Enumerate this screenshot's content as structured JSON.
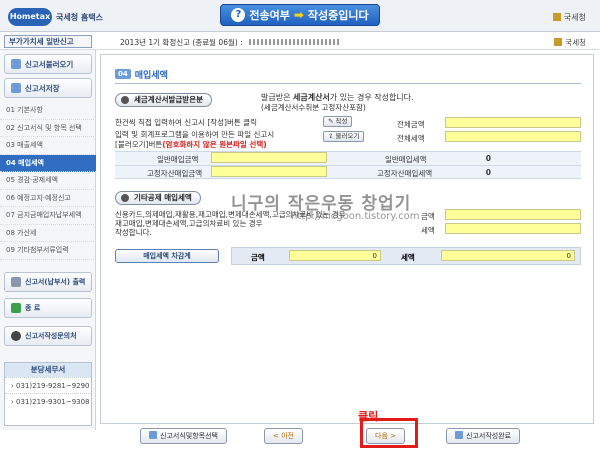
{
  "header": {
    "logo": "Hometax",
    "site_name": "국세청 홈택스",
    "banner_left": "전송여부",
    "banner_right": "작성중입니다",
    "brand": "국세청"
  },
  "subheader": {
    "tab": "부가가치세 일반신고",
    "filing_title": "2013년 1기 확정신고 (종료월 06월) :",
    "brand": "국세청"
  },
  "sidebar": {
    "buttons": {
      "load": "신고서불러오기",
      "save": "신고서저장"
    },
    "menu": [
      "01 기본사항",
      "02 신고서식 및 항목 선택",
      "03 매출세액",
      "04 매입세액",
      "05 경감·공제세액",
      "06 예정고지·예정신고",
      "07 금지금매입자납부세액",
      "08 가산세",
      "09 기타첨부서류입력"
    ],
    "active_index": 3,
    "print_btn": "신고서(납부서) 출력",
    "end_btn": "종 료",
    "contact_btn": "신고서작성문의처",
    "tax_office": {
      "title": "분당세무서",
      "phones": [
        "031)219-9281~9290",
        "031)219-9301~9308"
      ]
    }
  },
  "main": {
    "section_number": "04",
    "section_title": "매입세액",
    "panel1": {
      "label": "세금계산서발급받은분",
      "desc_prefix": "발급받은 ",
      "desc_bold": "세금계산서",
      "desc_suffix": "가 있는 경우 작성합니다.",
      "desc_sub": "(세금계산서수취분 고정자산포함)",
      "line1": "한건씩 직접 입력하여 신고시 [작성]버튼 클릭",
      "line2": "입력 및 회계프로그램을 이용하여 만든 파일 신고시",
      "line3_prefix": "[불러오기]버튼",
      "line3_red": "(암호화하지 않은 원본파일 선택)",
      "write_btn": "작성",
      "load_btn": "불러오기",
      "total_amount_label": "전체금액",
      "total_amount": "",
      "total_tax_label": "전체세액",
      "total_tax": "",
      "general_amount_label": "일반매입금액",
      "general_amount": "",
      "general_tax_label": "일반매입세액",
      "general_tax": "0",
      "fixed_amount_label": "고정자산매입금액",
      "fixed_amount": "",
      "fixed_tax_label": "고정자산매입세액",
      "fixed_tax": "0"
    },
    "panel2": {
      "label": "기타공제 매입세액",
      "line1": "신용카드,의제매입,재활용,재고매입,변제대손세액,고급의차료비 있는 경우",
      "line2": "재고매입,변제대손세액,고급의차료비 있는 경우",
      "line3": "작성합니다.",
      "amount_label": "금액",
      "amount": "",
      "tax_label": "세액",
      "tax": ""
    },
    "summary": {
      "button": "매입세액 차감계",
      "amount_label": "금액",
      "amount": "0",
      "tax_label": "세액",
      "tax": "0"
    },
    "watermark_title": "니구의 작은우동 창업기",
    "watermark_url": "http://nicgoon.tistory.com"
  },
  "footer": {
    "select_form_btn": "신고서식및항목선택",
    "prev_btn": "< 이전",
    "next_btn": "다음 >",
    "complete_btn": "신고서작성완료",
    "annotation": "클릭"
  },
  "colors": {
    "accent": "#2f6cc2",
    "input_yellow": "#ffff99",
    "annotation_red": "#e21b1b"
  }
}
